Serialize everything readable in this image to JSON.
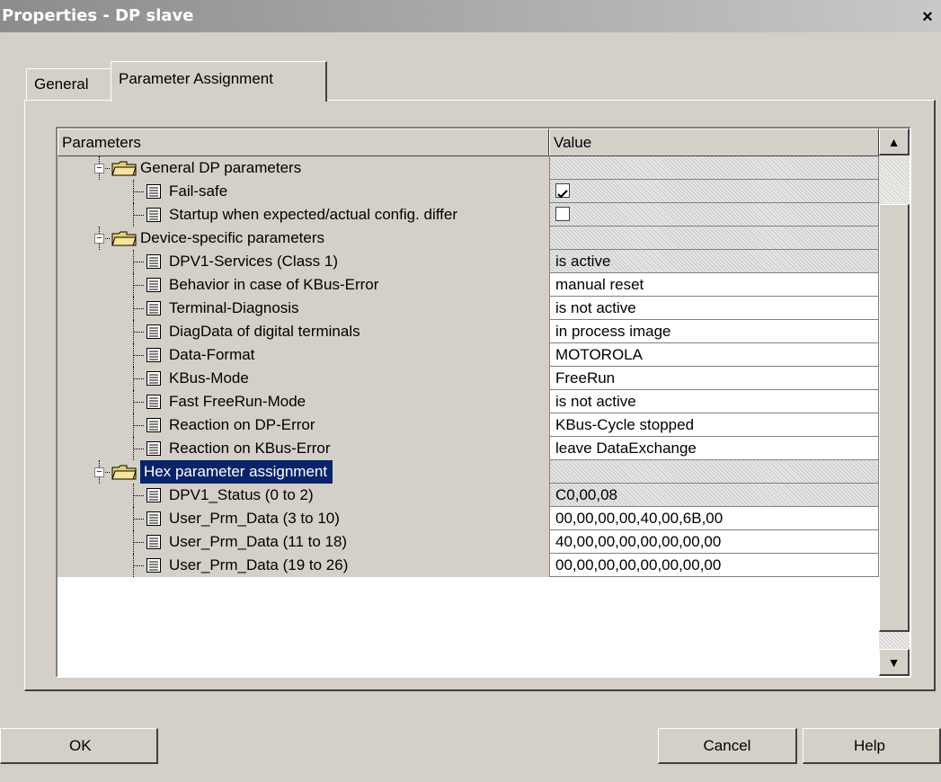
{
  "window": {
    "title": "Properties - DP slave",
    "close_label": "×"
  },
  "tabs": [
    {
      "label": "General"
    },
    {
      "label": "Parameter Assignment"
    }
  ],
  "grid": {
    "header": {
      "parameters": "Parameters",
      "value": "Value"
    },
    "rows": [
      {
        "label": "General DP parameters",
        "type": "folder",
        "level": 1,
        "value": ""
      },
      {
        "label": "Fail-safe",
        "type": "item",
        "level": 2,
        "checkbox": true,
        "checked": true
      },
      {
        "label": "Startup when expected/actual config. differ",
        "type": "item",
        "level": 2,
        "checkbox": true,
        "checked": false
      },
      {
        "label": "Device-specific parameters",
        "type": "folder",
        "level": 1,
        "value": ""
      },
      {
        "label": "DPV1-Services (Class 1)",
        "type": "item",
        "level": 2,
        "value": "is active",
        "readonly": true
      },
      {
        "label": "Behavior in case of KBus-Error",
        "type": "item",
        "level": 2,
        "value": "manual reset"
      },
      {
        "label": "Terminal-Diagnosis",
        "type": "item",
        "level": 2,
        "value": "is not active"
      },
      {
        "label": "DiagData of digital terminals",
        "type": "item",
        "level": 2,
        "value": "in process image"
      },
      {
        "label": "Data-Format",
        "type": "item",
        "level": 2,
        "value": "MOTOROLA"
      },
      {
        "label": "KBus-Mode",
        "type": "item",
        "level": 2,
        "value": "FreeRun"
      },
      {
        "label": "Fast FreeRun-Mode",
        "type": "item",
        "level": 2,
        "value": "is not active"
      },
      {
        "label": "Reaction on DP-Error",
        "type": "item",
        "level": 2,
        "value": "KBus-Cycle stopped"
      },
      {
        "label": "Reaction on KBus-Error",
        "type": "item",
        "level": 2,
        "value": "leave DataExchange"
      },
      {
        "label": "Hex parameter assignment",
        "type": "folder",
        "level": 1,
        "value": "",
        "selected": true
      },
      {
        "label": "DPV1_Status (0 to 2)",
        "type": "item",
        "level": 2,
        "value": "C0,00,08",
        "readonly": true
      },
      {
        "label": "User_Prm_Data (3 to 10)",
        "type": "item",
        "level": 2,
        "value": "00,00,00,00,40,00,6B,00"
      },
      {
        "label": "User_Prm_Data (11 to 18)",
        "type": "item",
        "level": 2,
        "value": "40,00,00,00,00,00,00,00"
      },
      {
        "label": "User_Prm_Data (19 to 26)",
        "type": "item",
        "level": 2,
        "value": "00,00,00,00,00,00,00,00"
      }
    ]
  },
  "buttons": {
    "ok": "OK",
    "cancel": "Cancel",
    "help": "Help"
  },
  "scrollbar": {
    "up_icon": "▲",
    "down_icon": "▼"
  },
  "colors": {
    "selection": "#0a246a",
    "dialog_bg": "#d4d0c8"
  }
}
